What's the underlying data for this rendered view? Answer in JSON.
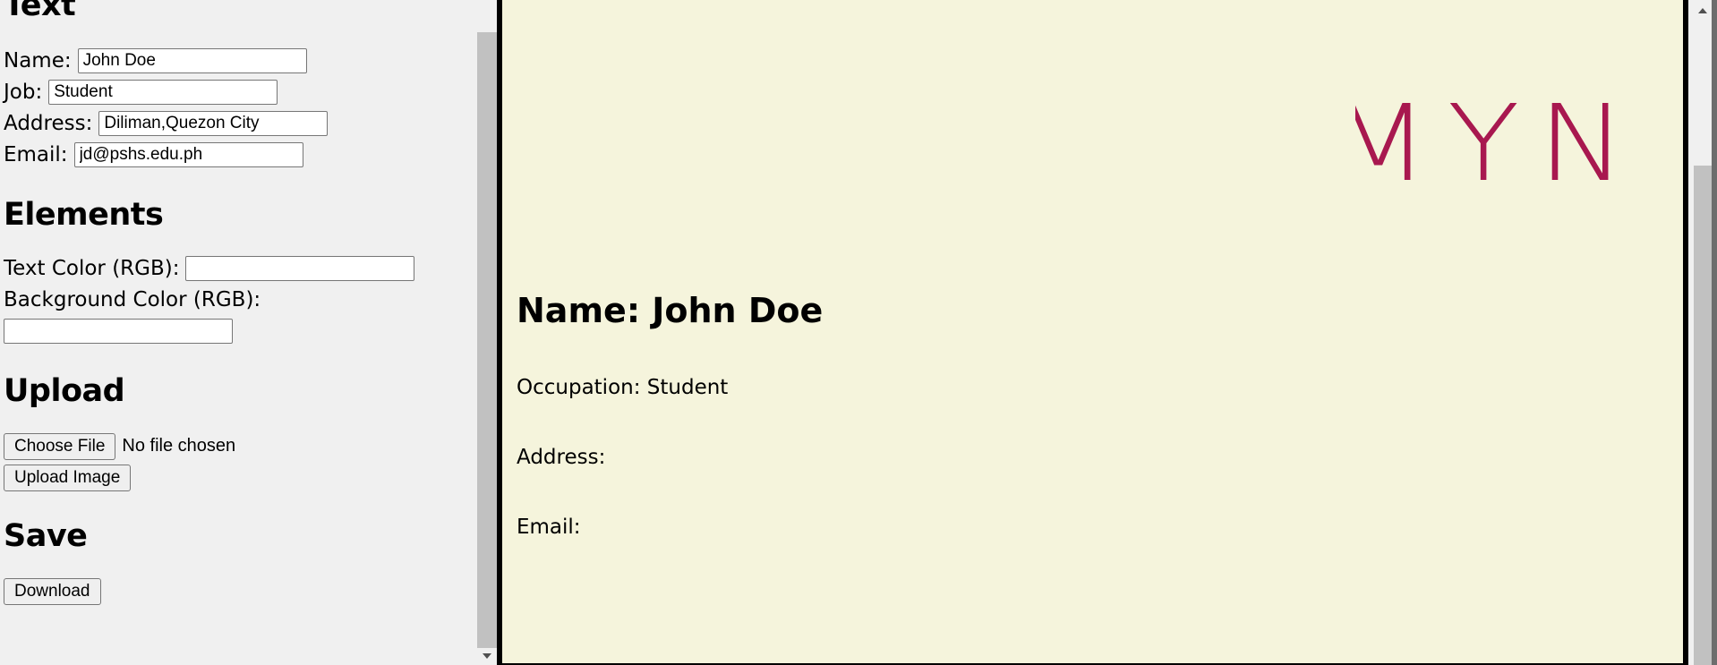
{
  "editor": {
    "text_section": {
      "heading": "Text",
      "name_label": "Name:",
      "name_value": "John Doe",
      "job_label": "Job:",
      "job_value": "Student",
      "address_label": "Address:",
      "address_value": "Diliman,Quezon City",
      "email_label": "Email:",
      "email_value": "jd@pshs.edu.ph"
    },
    "elements_section": {
      "heading": "Elements",
      "text_color_label": "Text Color (RGB):",
      "text_color_value": "",
      "bg_color_label": "Background Color (RGB):",
      "bg_color_value": ""
    },
    "upload_section": {
      "heading": "Upload",
      "choose_file_label": "Choose File",
      "file_status": "No file chosen",
      "upload_button_label": "Upload Image"
    },
    "save_section": {
      "heading": "Save",
      "download_label": "Download"
    }
  },
  "preview": {
    "name_line": "Name: John Doe",
    "occupation_line": "Occupation: Student",
    "address_line": "Address:",
    "email_line": "Email:",
    "logo_text": "MYN",
    "logo_color": "#a8184f",
    "background_color": "#f5f4dc"
  }
}
